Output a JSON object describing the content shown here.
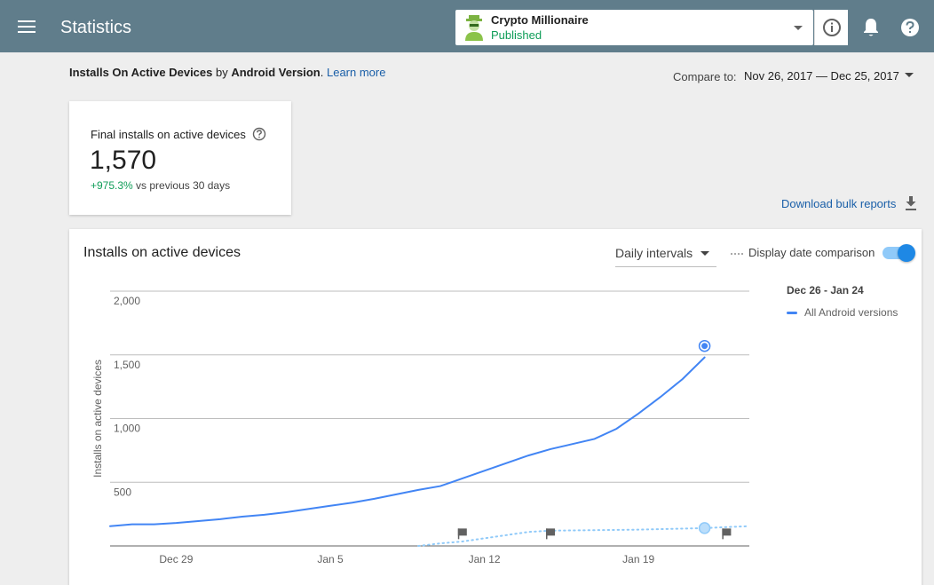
{
  "header": {
    "title": "Statistics",
    "app_name": "Crypto Millionaire",
    "app_status": "Published"
  },
  "report": {
    "title_bold": "Installs On Active Devices",
    "title_by": " by ",
    "title_dimension": "Android Version",
    "title_dot": ". ",
    "learn_more": "Learn more",
    "compare_label": "Compare to:",
    "compare_range": "Nov 26, 2017 — Dec 25, 2017"
  },
  "kpi": {
    "label": "Final installs on active devices",
    "value": "1,570",
    "change_pct": "+975.3%",
    "change_text": " vs previous 30 days"
  },
  "download": {
    "label": "Download bulk reports"
  },
  "chart_card": {
    "title": "Installs on active devices",
    "interval": "Daily intervals",
    "compare_toggle": "Display date comparison",
    "legend_range": "Dec 26 - Jan 24",
    "legend_series": "All Android versions"
  },
  "colors": {
    "primary": "#4285f4",
    "comparison": "#90caf9",
    "header": "#607d8b",
    "positive": "#0f9d58"
  },
  "chart_data": {
    "type": "line",
    "ylabel": "Installs on active devices",
    "ylim": [
      0,
      2000
    ],
    "y_ticks": [
      500,
      1000,
      1500,
      2000
    ],
    "y_tick_labels": [
      "500",
      "1,000",
      "1,500",
      "2,000"
    ],
    "x_ticks": [
      {
        "day": 3,
        "label": "Dec 29"
      },
      {
        "day": 10,
        "label": "Jan 5"
      },
      {
        "day": 17,
        "label": "Jan 12"
      },
      {
        "day": 24,
        "label": "Jan 19"
      }
    ],
    "x_max_day": 29,
    "series": [
      {
        "name": "All Android versions",
        "style": "solid",
        "days": [
          0,
          1,
          2,
          3,
          4,
          5,
          6,
          7,
          8,
          9,
          10,
          11,
          12,
          13,
          14,
          15,
          16,
          17,
          18,
          19,
          20,
          21,
          22,
          23,
          24,
          25,
          26,
          27
        ],
        "values": [
          155,
          170,
          170,
          180,
          195,
          210,
          230,
          245,
          265,
          290,
          315,
          340,
          370,
          405,
          440,
          470,
          530,
          590,
          650,
          710,
          760,
          800,
          840,
          920,
          1040,
          1170,
          1310,
          1480
        ],
        "end_day": 27,
        "end_value": 1570
      },
      {
        "name": "Nov 26, 2017 — Dec 25, 2017",
        "style": "dotted",
        "days": [
          14,
          15,
          16,
          17,
          18,
          19,
          20,
          21,
          22,
          23,
          24,
          25,
          26,
          27,
          28,
          29
        ],
        "values": [
          0,
          20,
          35,
          60,
          85,
          110,
          120,
          122,
          124,
          126,
          128,
          132,
          136,
          140,
          148,
          155
        ],
        "end_day": 27,
        "end_value": 140
      }
    ],
    "annotations": [
      {
        "day": 16,
        "value": 95
      },
      {
        "day": 20,
        "value": 95
      },
      {
        "day": 28,
        "value": 95
      }
    ]
  }
}
